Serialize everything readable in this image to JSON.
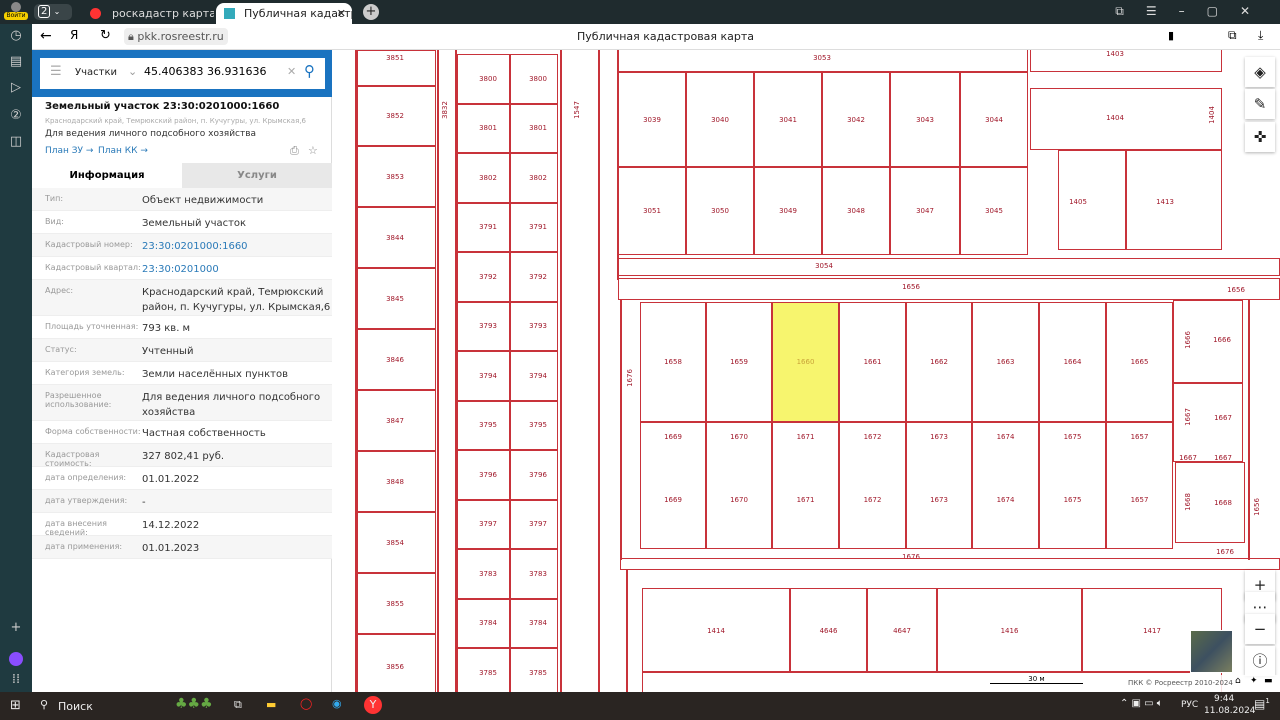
{
  "browser": {
    "profile_label": "Войти",
    "tab_count": "2",
    "tabs": [
      {
        "title": "роскадастр карта — Яндекс"
      },
      {
        "title": "Публичная кадастровая карта"
      }
    ],
    "url": "pkk.rosreestr.ru",
    "page_title": "Публичная кадастровая карта"
  },
  "search": {
    "category": "Участки",
    "query": "45.406383 36.931636"
  },
  "object": {
    "title": "Земельный участок 23:30:0201000:1660",
    "address_short": "Краснодарский край, Темрюкский район, п. Кучугуры, ул. Крымская,6",
    "usage": "Для ведения личного подсобного хозяйства",
    "link_plan_zu": "План ЗУ →",
    "link_plan_kk": "План КК →"
  },
  "tabs": {
    "info": "Информация",
    "services": "Услуги"
  },
  "fields": [
    {
      "label": "Тип:",
      "value": "Объект недвижимости"
    },
    {
      "label": "Вид:",
      "value": "Земельный участок"
    },
    {
      "label": "Кадастровый номер:",
      "value": "23:30:0201000:1660",
      "link": true
    },
    {
      "label": "Кадастровый квартал:",
      "value": "23:30:0201000",
      "link": true
    },
    {
      "label": "Адрес:",
      "value": "Краснодарский край, Темрюкский район, п. Кучугуры, ул. Крымская,6"
    },
    {
      "label": "Площадь уточненная:",
      "value": "793 кв. м"
    },
    {
      "label": "Статус:",
      "value": "Учтенный"
    },
    {
      "label": "Категория земель:",
      "value": "Земли населённых пунктов"
    },
    {
      "label": "Разрешенное использование:",
      "value": "Для ведения личного подсобного хозяйства"
    },
    {
      "label": "Форма собственности:",
      "value": "Частная собственность"
    },
    {
      "label": "Кадастровая стоимость:",
      "value": "327 802,41 руб."
    },
    {
      "label": "дата определения:",
      "value": "01.01.2022"
    },
    {
      "label": "дата утверждения:",
      "value": "-"
    },
    {
      "label": "дата внесения сведений:",
      "value": "14.12.2022"
    },
    {
      "label": "дата применения:",
      "value": "01.01.2023"
    }
  ],
  "map": {
    "selected": "1660",
    "highlight_color": "#f7f56e",
    "line_color": "#c8323a",
    "left_col": [
      "3851",
      "3852",
      "3853",
      "3844",
      "3845",
      "3846",
      "3847",
      "3848",
      "3854",
      "3855",
      "3856"
    ],
    "mid_col": [
      "3800",
      "3801",
      "3802",
      "3791",
      "3792",
      "3793",
      "3794",
      "3795",
      "3796",
      "3797",
      "3783",
      "3784",
      "3785"
    ],
    "streets": [
      "3832",
      "1547",
      "3053",
      "1403",
      "3054",
      "1656",
      "1656",
      "1676",
      "1676",
      "1676",
      "1656",
      "1404"
    ],
    "top_row": [
      "3039",
      "3040",
      "3041",
      "3042",
      "3043",
      "3044"
    ],
    "second_row": [
      "3051",
      "3050",
      "3049",
      "3048",
      "3047",
      "3045"
    ],
    "top_right": [
      "1404",
      "1405",
      "1413"
    ],
    "block_row1": [
      "1658",
      "1659",
      "1660",
      "1661",
      "1662",
      "1663",
      "1664",
      "1665"
    ],
    "block_row2": [
      "1669",
      "1670",
      "1671",
      "1672",
      "1673",
      "1674",
      "1675",
      "1657"
    ],
    "block_right": [
      "1666",
      "1666",
      "1667",
      "1667",
      "1667",
      "1667",
      "1668",
      "1668"
    ],
    "bottom_row": [
      "1414",
      "4646",
      "4647",
      "1416",
      "1417"
    ],
    "scale": "30 м",
    "copyright": "ПКК © Росреестр 2010-2024"
  },
  "taskbar": {
    "search": "Поиск",
    "lang": "РУС",
    "time": "9:44",
    "date": "11.08.2024",
    "notifications": "1"
  }
}
